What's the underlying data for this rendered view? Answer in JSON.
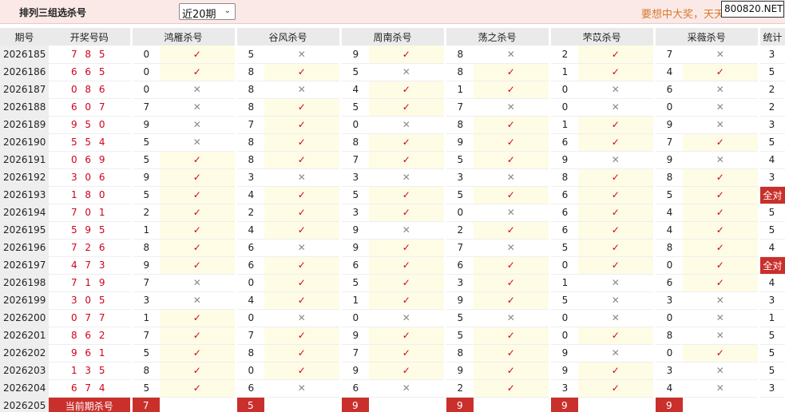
{
  "header": {
    "title": "排列三组选杀号",
    "select_value": "近20期",
    "promo_text": "要想中大奖，天天",
    "site_badge": "800820.NET"
  },
  "table": {
    "columns": [
      "期号",
      "开奖号码",
      "鸿雁杀号",
      "谷风杀号",
      "周南杀号",
      "荡之杀号",
      "芣苡杀号",
      "采薇杀号",
      "统计"
    ],
    "rows": [
      {
        "period": "2026185",
        "draw": "7 8 5",
        "kills": [
          {
            "n": "0",
            "ok": true
          },
          {
            "n": "5",
            "ok": false
          },
          {
            "n": "9",
            "ok": true
          },
          {
            "n": "8",
            "ok": false
          },
          {
            "n": "2",
            "ok": true
          },
          {
            "n": "7",
            "ok": false
          }
        ],
        "stat": "3"
      },
      {
        "period": "2026186",
        "draw": "6 6 5",
        "kills": [
          {
            "n": "0",
            "ok": true
          },
          {
            "n": "8",
            "ok": true
          },
          {
            "n": "5",
            "ok": false
          },
          {
            "n": "8",
            "ok": true
          },
          {
            "n": "1",
            "ok": true
          },
          {
            "n": "4",
            "ok": true
          }
        ],
        "stat": "5"
      },
      {
        "period": "2026187",
        "draw": "0 8 6",
        "kills": [
          {
            "n": "0",
            "ok": false
          },
          {
            "n": "8",
            "ok": false
          },
          {
            "n": "4",
            "ok": true
          },
          {
            "n": "1",
            "ok": true
          },
          {
            "n": "0",
            "ok": false
          },
          {
            "n": "6",
            "ok": false
          }
        ],
        "stat": "2"
      },
      {
        "period": "2026188",
        "draw": "6 0 7",
        "kills": [
          {
            "n": "7",
            "ok": false
          },
          {
            "n": "8",
            "ok": true
          },
          {
            "n": "5",
            "ok": true
          },
          {
            "n": "7",
            "ok": false
          },
          {
            "n": "0",
            "ok": false
          },
          {
            "n": "0",
            "ok": false
          }
        ],
        "stat": "2"
      },
      {
        "period": "2026189",
        "draw": "9 5 0",
        "kills": [
          {
            "n": "9",
            "ok": false
          },
          {
            "n": "7",
            "ok": true
          },
          {
            "n": "0",
            "ok": false
          },
          {
            "n": "8",
            "ok": true
          },
          {
            "n": "1",
            "ok": true
          },
          {
            "n": "9",
            "ok": false
          }
        ],
        "stat": "3"
      },
      {
        "period": "2026190",
        "draw": "5 5 4",
        "kills": [
          {
            "n": "5",
            "ok": false
          },
          {
            "n": "8",
            "ok": true
          },
          {
            "n": "8",
            "ok": true
          },
          {
            "n": "9",
            "ok": true
          },
          {
            "n": "6",
            "ok": true
          },
          {
            "n": "7",
            "ok": true
          }
        ],
        "stat": "5"
      },
      {
        "period": "2026191",
        "draw": "0 6 9",
        "kills": [
          {
            "n": "5",
            "ok": true
          },
          {
            "n": "8",
            "ok": true
          },
          {
            "n": "7",
            "ok": true
          },
          {
            "n": "5",
            "ok": true
          },
          {
            "n": "9",
            "ok": false
          },
          {
            "n": "9",
            "ok": false
          }
        ],
        "stat": "4"
      },
      {
        "period": "2026192",
        "draw": "3 0 6",
        "kills": [
          {
            "n": "9",
            "ok": true
          },
          {
            "n": "3",
            "ok": false
          },
          {
            "n": "3",
            "ok": false
          },
          {
            "n": "3",
            "ok": false
          },
          {
            "n": "8",
            "ok": true
          },
          {
            "n": "8",
            "ok": true
          }
        ],
        "stat": "3"
      },
      {
        "period": "2026193",
        "draw": "1 8 0",
        "kills": [
          {
            "n": "5",
            "ok": true
          },
          {
            "n": "4",
            "ok": true
          },
          {
            "n": "5",
            "ok": true
          },
          {
            "n": "5",
            "ok": true
          },
          {
            "n": "6",
            "ok": true
          },
          {
            "n": "5",
            "ok": true
          }
        ],
        "stat": "全对",
        "stat_hi": true
      },
      {
        "period": "2026194",
        "draw": "7 0 1",
        "kills": [
          {
            "n": "2",
            "ok": true
          },
          {
            "n": "2",
            "ok": true
          },
          {
            "n": "3",
            "ok": true
          },
          {
            "n": "0",
            "ok": false
          },
          {
            "n": "6",
            "ok": true
          },
          {
            "n": "4",
            "ok": true
          }
        ],
        "stat": "5"
      },
      {
        "period": "2026195",
        "draw": "5 9 5",
        "kills": [
          {
            "n": "1",
            "ok": true
          },
          {
            "n": "4",
            "ok": true
          },
          {
            "n": "9",
            "ok": false
          },
          {
            "n": "2",
            "ok": true
          },
          {
            "n": "6",
            "ok": true
          },
          {
            "n": "4",
            "ok": true
          }
        ],
        "stat": "5"
      },
      {
        "period": "2026196",
        "draw": "7 2 6",
        "kills": [
          {
            "n": "8",
            "ok": true
          },
          {
            "n": "6",
            "ok": false
          },
          {
            "n": "9",
            "ok": true
          },
          {
            "n": "7",
            "ok": false
          },
          {
            "n": "5",
            "ok": true
          },
          {
            "n": "8",
            "ok": true
          }
        ],
        "stat": "4"
      },
      {
        "period": "2026197",
        "draw": "4 7 3",
        "kills": [
          {
            "n": "9",
            "ok": true
          },
          {
            "n": "6",
            "ok": true
          },
          {
            "n": "6",
            "ok": true
          },
          {
            "n": "6",
            "ok": true
          },
          {
            "n": "0",
            "ok": true
          },
          {
            "n": "0",
            "ok": true
          }
        ],
        "stat": "全对",
        "stat_hi": true
      },
      {
        "period": "2026198",
        "draw": "7 1 9",
        "kills": [
          {
            "n": "7",
            "ok": false
          },
          {
            "n": "0",
            "ok": true
          },
          {
            "n": "5",
            "ok": true
          },
          {
            "n": "3",
            "ok": true
          },
          {
            "n": "1",
            "ok": false
          },
          {
            "n": "6",
            "ok": true
          }
        ],
        "stat": "4"
      },
      {
        "period": "2026199",
        "draw": "3 0 5",
        "kills": [
          {
            "n": "3",
            "ok": false
          },
          {
            "n": "4",
            "ok": true
          },
          {
            "n": "1",
            "ok": true
          },
          {
            "n": "9",
            "ok": true
          },
          {
            "n": "5",
            "ok": false
          },
          {
            "n": "3",
            "ok": false
          }
        ],
        "stat": "3"
      },
      {
        "period": "2026200",
        "draw": "0 7 7",
        "kills": [
          {
            "n": "1",
            "ok": true
          },
          {
            "n": "0",
            "ok": false
          },
          {
            "n": "0",
            "ok": false
          },
          {
            "n": "5",
            "ok": false
          },
          {
            "n": "0",
            "ok": false
          },
          {
            "n": "0",
            "ok": false
          }
        ],
        "stat": "1"
      },
      {
        "period": "2026201",
        "draw": "8 6 2",
        "kills": [
          {
            "n": "7",
            "ok": true
          },
          {
            "n": "7",
            "ok": true
          },
          {
            "n": "9",
            "ok": true
          },
          {
            "n": "5",
            "ok": true
          },
          {
            "n": "0",
            "ok": true
          },
          {
            "n": "8",
            "ok": false
          }
        ],
        "stat": "5"
      },
      {
        "period": "2026202",
        "draw": "9 6 1",
        "kills": [
          {
            "n": "5",
            "ok": true
          },
          {
            "n": "8",
            "ok": true
          },
          {
            "n": "7",
            "ok": true
          },
          {
            "n": "8",
            "ok": true
          },
          {
            "n": "9",
            "ok": false
          },
          {
            "n": "0",
            "ok": true
          }
        ],
        "stat": "5"
      },
      {
        "period": "2026203",
        "draw": "1 3 5",
        "kills": [
          {
            "n": "8",
            "ok": true
          },
          {
            "n": "0",
            "ok": true
          },
          {
            "n": "9",
            "ok": true
          },
          {
            "n": "9",
            "ok": true
          },
          {
            "n": "9",
            "ok": true
          },
          {
            "n": "3",
            "ok": false
          }
        ],
        "stat": "5"
      },
      {
        "period": "2026204",
        "draw": "6 7 4",
        "kills": [
          {
            "n": "5",
            "ok": true
          },
          {
            "n": "6",
            "ok": false
          },
          {
            "n": "6",
            "ok": false
          },
          {
            "n": "2",
            "ok": true
          },
          {
            "n": "3",
            "ok": true
          },
          {
            "n": "4",
            "ok": false
          }
        ],
        "stat": "3"
      }
    ],
    "current": {
      "period": "2026205",
      "label": "当前期杀号",
      "kills": [
        "7",
        "5",
        "9",
        "9",
        "9",
        "9"
      ]
    },
    "marks": {
      "ok": "✓",
      "no": "✕"
    }
  },
  "colors": {
    "accent_red": "#d0021b",
    "highlight_red": "#c9302c",
    "ok_cell_bg": "#fffce6",
    "header_bg": "#eaeaea",
    "topbar_bg": "#fbe9e8"
  }
}
